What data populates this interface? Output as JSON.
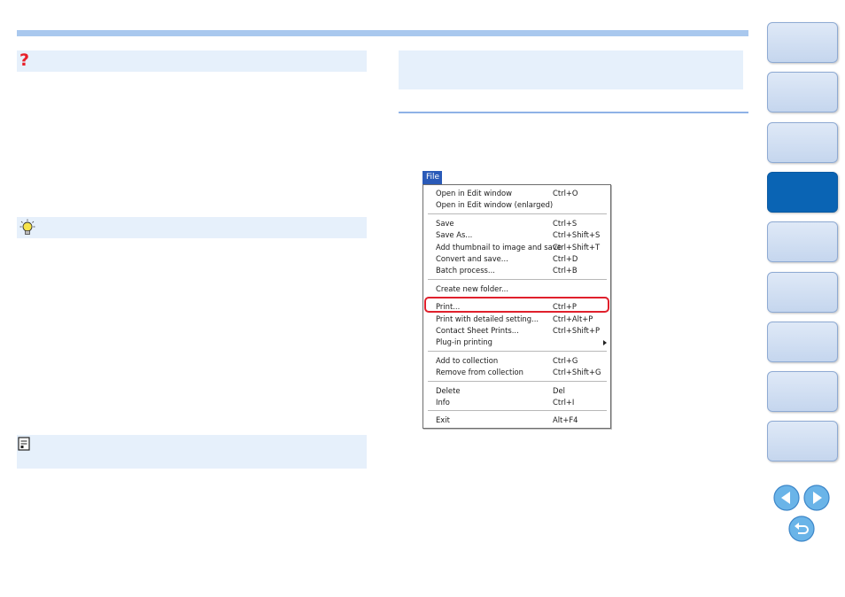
{
  "colors": {
    "accent_bar": "#a9c8ee",
    "panel_bg": "#e6f0fb",
    "nav_active": "#0a64b4",
    "nav_inactive": "#d6e3f4",
    "highlight": "#e0202c",
    "question_mark": "#e8202a"
  },
  "icons": {
    "question": "question-mark-icon",
    "tip": "lightbulb-icon",
    "note": "memo-icon",
    "prev": "previous-page-icon",
    "next": "next-page-icon",
    "back": "return-icon"
  },
  "menu": {
    "title": "File",
    "groups": [
      [
        {
          "label": "Open in Edit window",
          "shortcut": "Ctrl+O"
        },
        {
          "label": "Open in Edit window (enlarged)",
          "shortcut": ""
        }
      ],
      [
        {
          "label": "Save",
          "shortcut": "Ctrl+S"
        },
        {
          "label": "Save As...",
          "shortcut": "Ctrl+Shift+S"
        },
        {
          "label": "Add thumbnail to image and save",
          "shortcut": "Ctrl+Shift+T"
        },
        {
          "label": "Convert and save...",
          "shortcut": "Ctrl+D"
        },
        {
          "label": "Batch process...",
          "shortcut": "Ctrl+B"
        }
      ],
      [
        {
          "label": "Create new folder...",
          "shortcut": ""
        }
      ],
      [
        {
          "label": "Print...",
          "shortcut": "Ctrl+P"
        },
        {
          "label": "Print with detailed setting...",
          "shortcut": "Ctrl+Alt+P"
        },
        {
          "label": "Contact Sheet Prints...",
          "shortcut": "Ctrl+Shift+P"
        },
        {
          "label": "Plug-in printing",
          "shortcut": "",
          "submenu": true
        }
      ],
      [
        {
          "label": "Add to collection",
          "shortcut": "Ctrl+G"
        },
        {
          "label": "Remove from collection",
          "shortcut": "Ctrl+Shift+G"
        }
      ],
      [
        {
          "label": "Delete",
          "shortcut": "Del"
        },
        {
          "label": "Info",
          "shortcut": "Ctrl+I"
        }
      ],
      [
        {
          "label": "Exit",
          "shortcut": "Alt+F4"
        }
      ]
    ],
    "highlighted_item": "Print..."
  },
  "nav": {
    "tab_count": 9,
    "active_tab_index": 3
  }
}
